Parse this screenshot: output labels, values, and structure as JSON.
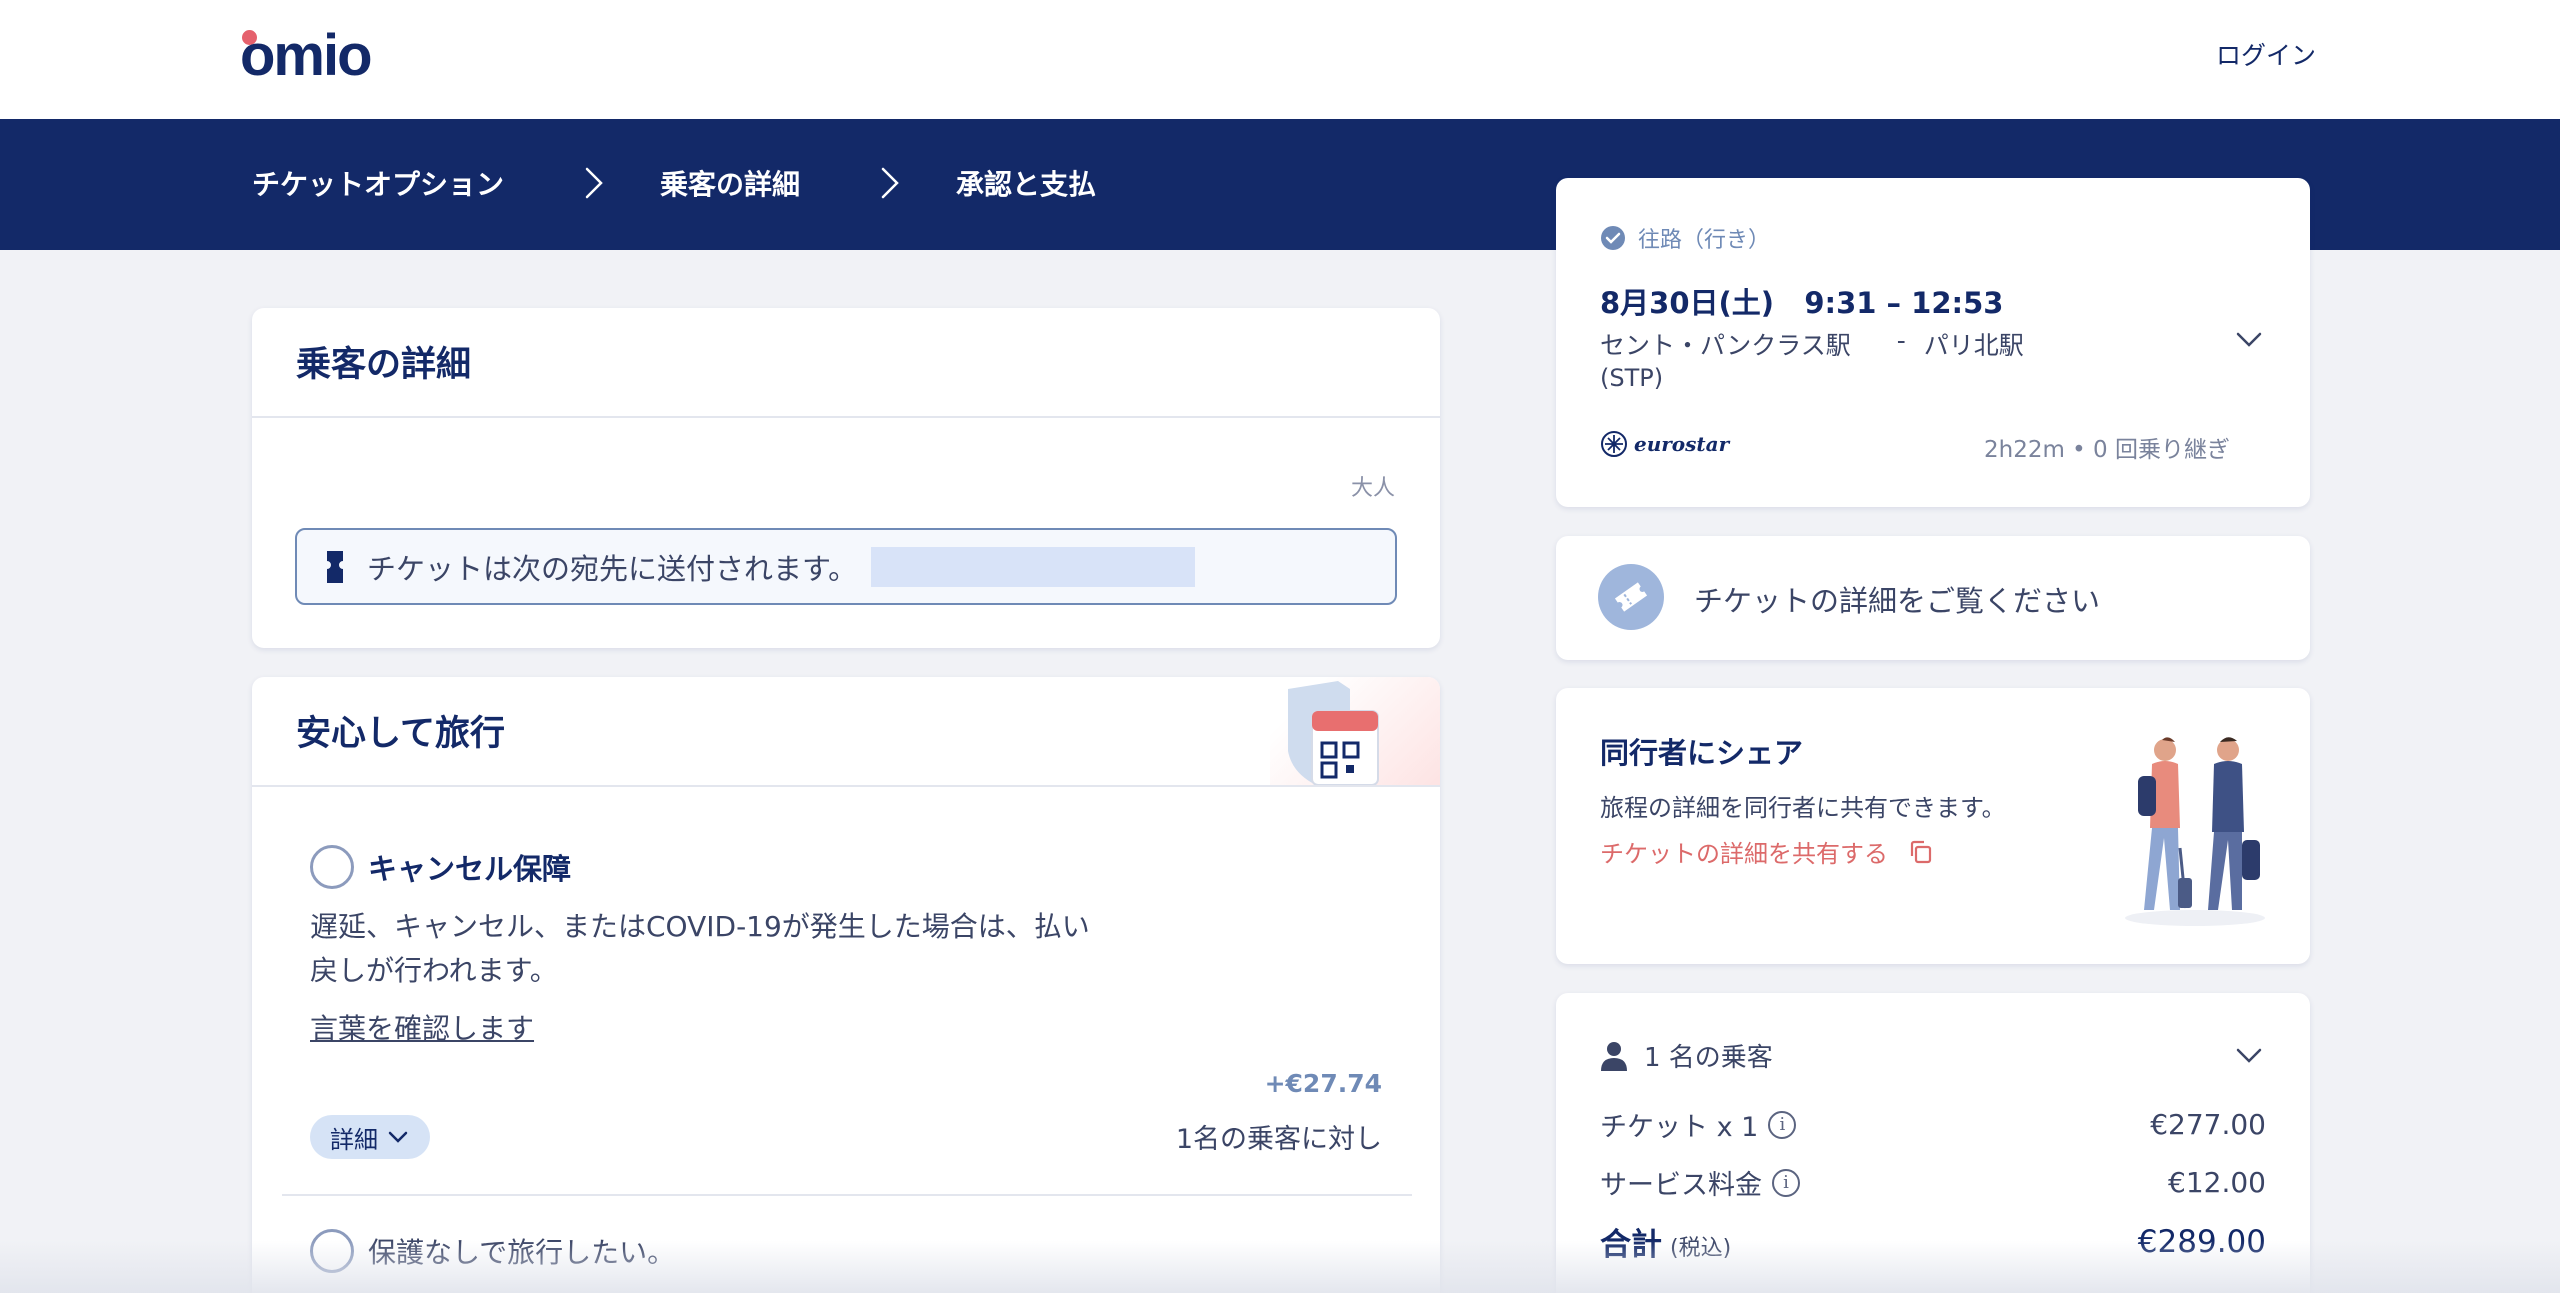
{
  "header": {
    "logo_text": "omio",
    "login_label": "ログイン"
  },
  "steps": [
    {
      "label": "チケットオプション"
    },
    {
      "label": "乗客の詳細"
    },
    {
      "label": "承認と支払"
    }
  ],
  "passenger_card": {
    "title": "乗客の詳細",
    "passenger_type": "大人",
    "ticket_destination_text": "チケットは次の宛先に送付されます。"
  },
  "travel_card": {
    "title": "安心して旅行",
    "option_cancel": {
      "title": "キャンセル保障",
      "description_line1": "遅延、キャンセル、またはCOVID-19が発生した場合は、払い",
      "description_line2": "戻しが行われます。",
      "terms_link": "言葉を確認します",
      "price": "+€27.74",
      "per_passenger": "1名の乗客に対し",
      "details_label": "詳細"
    },
    "option_none": {
      "title": "保護なしで旅行したい。"
    }
  },
  "trip_card": {
    "direction_label": "往路（行き）",
    "date_time": "8月30日(土)   9:31 – 12:53",
    "origin": "セント・パンクラス駅",
    "origin_code": "(STP)",
    "separator": "-",
    "destination": "パリ北駅",
    "carrier": "eurostar",
    "duration_changes": "2h22m • 0 回乗り継ぎ"
  },
  "ticket_details_card": {
    "label": "チケットの詳細をご覧ください"
  },
  "share_card": {
    "title": "同行者にシェア",
    "description": "旅程の詳細を同行者に共有できます。",
    "share_link": "チケットの詳細を共有する"
  },
  "price_card": {
    "passengers_label": "1 名の乗客",
    "ticket_label": "チケット x 1",
    "ticket_price": "€277.00",
    "service_label": "サービス料金",
    "service_price": "€12.00",
    "total_label": "合計",
    "total_tax_note": "(税込)",
    "total_price": "€289.00"
  },
  "colors": {
    "navy": "#132968",
    "accent_red": "#e5616d",
    "link_red": "#dc6a6a",
    "price_blue": "#6f8ab6",
    "background": "#f1f2f6"
  },
  "icons": [
    "chevron-right-icon",
    "ticket-icon",
    "check-circle-icon",
    "chevron-down-icon",
    "eurostar-logo-icon",
    "ticket-badge-icon",
    "copy-icon",
    "user-icon",
    "info-icon",
    "shield-ticket-illustration",
    "travelers-illustration"
  ]
}
